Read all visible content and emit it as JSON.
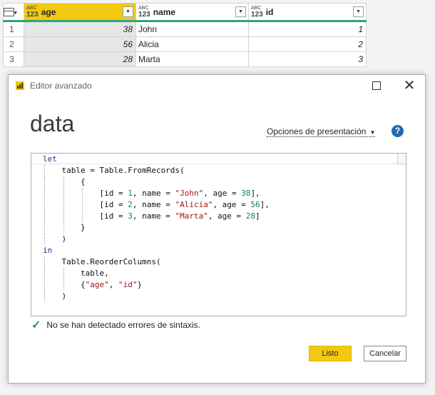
{
  "grid": {
    "columns": [
      {
        "type_top": "ABC",
        "type_bottom": "123",
        "name": "age"
      },
      {
        "type_top": "ABC",
        "type_bottom": "123",
        "name": "name"
      },
      {
        "type_top": "ABC",
        "type_bottom": "123",
        "name": "id"
      }
    ],
    "rows": [
      {
        "num": "1",
        "age": "38",
        "name": "John",
        "id": "1"
      },
      {
        "num": "2",
        "age": "56",
        "name": "Alicia",
        "id": "2"
      },
      {
        "num": "3",
        "age": "28",
        "name": "Marta",
        "id": "3"
      }
    ]
  },
  "dialog": {
    "title": "Editor avanzado",
    "query_name": "data",
    "display_options": "Opciones de presentación",
    "help_glyph": "?",
    "status": "No se han detectado errores de sintaxis.",
    "ok_label": "Listo",
    "cancel_label": "Cancelar"
  },
  "code_lines": [
    [
      {
        "t": "let",
        "c": "kw"
      }
    ],
    [
      {
        "t": "    table = Table.FromRecords(",
        "c": "plain"
      }
    ],
    [
      {
        "t": "        {",
        "c": "plain"
      }
    ],
    [
      {
        "t": "            [id = ",
        "c": "plain"
      },
      {
        "t": "1",
        "c": "num"
      },
      {
        "t": ", name = ",
        "c": "plain"
      },
      {
        "t": "\"John\"",
        "c": "str"
      },
      {
        "t": ", age = ",
        "c": "plain"
      },
      {
        "t": "38",
        "c": "num"
      },
      {
        "t": "],",
        "c": "plain"
      }
    ],
    [
      {
        "t": "            [id = ",
        "c": "plain"
      },
      {
        "t": "2",
        "c": "num"
      },
      {
        "t": ", name = ",
        "c": "plain"
      },
      {
        "t": "\"Alicia\"",
        "c": "str"
      },
      {
        "t": ", age = ",
        "c": "plain"
      },
      {
        "t": "56",
        "c": "num"
      },
      {
        "t": "],",
        "c": "plain"
      }
    ],
    [
      {
        "t": "            [id = ",
        "c": "plain"
      },
      {
        "t": "3",
        "c": "num"
      },
      {
        "t": ", name = ",
        "c": "plain"
      },
      {
        "t": "\"Marta\"",
        "c": "str"
      },
      {
        "t": ", age = ",
        "c": "plain"
      },
      {
        "t": "28",
        "c": "num"
      },
      {
        "t": "]",
        "c": "plain"
      }
    ],
    [
      {
        "t": "        }",
        "c": "plain"
      }
    ],
    [
      {
        "t": "    )",
        "c": "plain"
      }
    ],
    [
      {
        "t": "in",
        "c": "kw"
      }
    ],
    [
      {
        "t": "    Table.ReorderColumns(",
        "c": "plain"
      }
    ],
    [
      {
        "t": "        table,",
        "c": "plain"
      }
    ],
    [
      {
        "t": "        {",
        "c": "plain"
      },
      {
        "t": "\"age\"",
        "c": "str"
      },
      {
        "t": ", ",
        "c": "plain"
      },
      {
        "t": "\"id\"",
        "c": "str"
      },
      {
        "t": "}",
        "c": "plain"
      }
    ],
    [
      {
        "t": "    )",
        "c": "plain"
      }
    ]
  ],
  "colors": {
    "accent": "#f2c811",
    "column_quality": "#29a87f",
    "keyword": "#16378c",
    "string": "#a31515",
    "number": "#098658",
    "check": "#2e9d47",
    "help": "#1e6cb3"
  }
}
